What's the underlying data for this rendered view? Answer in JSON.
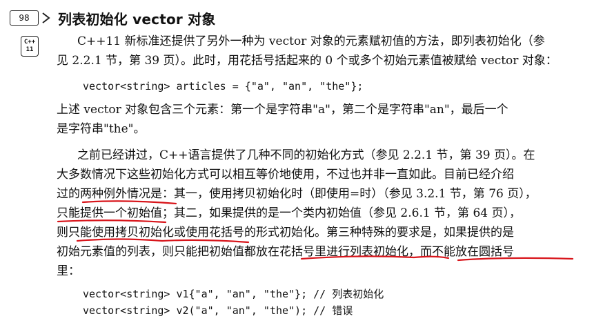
{
  "heading": {
    "page_number": "98",
    "title": "列表初始化 vector 对象"
  },
  "badge": {
    "line1": "C++",
    "line2": "11"
  },
  "paragraph1": {
    "line1": "C++11 新标准还提供了另外一种为 vector 对象的元素赋初值的方法，即列表初始化（参",
    "line2": "见 2.2.1 节，第 39 页）。此时，用花括号括起来的 0 个或多个初始元素值被赋给 vector 对象："
  },
  "code1": "vector<string> articles = {\"a\", \"an\", \"the\"};",
  "paragraph2": {
    "line1": "上述 vector 对象包含三个元素：第一个是字符串\"a\"，第二个是字符串\"an\"，最后一个",
    "line2": "是字符串\"the\"。"
  },
  "paragraph3": {
    "line1": "之前已经讲过，C++语言提供了几种不同的初始化方式（参见 2.2.1 节，第 39 页）。在",
    "line2": "大多数情况下这些初始化方式可以相互等价地使用，不过也并非一直如此。目前已经介绍",
    "line3": "过的两种例外情况是：其一，使用拷贝初始化时（即使用=时）（参见 3.2.1 节，第 76 页），",
    "line4": "只能提供一个初始值；其二，如果提供的是一个类内初始值（参见 2.6.1 节，第 64 页），",
    "line5": "则只能使用拷贝初始化或使用花括号的形式初始化。第三种特殊的要求是，如果提供的是",
    "line6": "初始元素值的列表，则只能把初始值都放在花括号里进行列表初始化，而不能放在圆括号",
    "line7": "里："
  },
  "code2": {
    "line1": "vector<string> v1{\"a\", \"an\", \"the\"}; // 列表初始化",
    "line2": "vector<string> v2(\"a\", \"an\", \"the\"); // 错误"
  },
  "colors": {
    "underline": "#d8151b",
    "text": "#111111"
  }
}
